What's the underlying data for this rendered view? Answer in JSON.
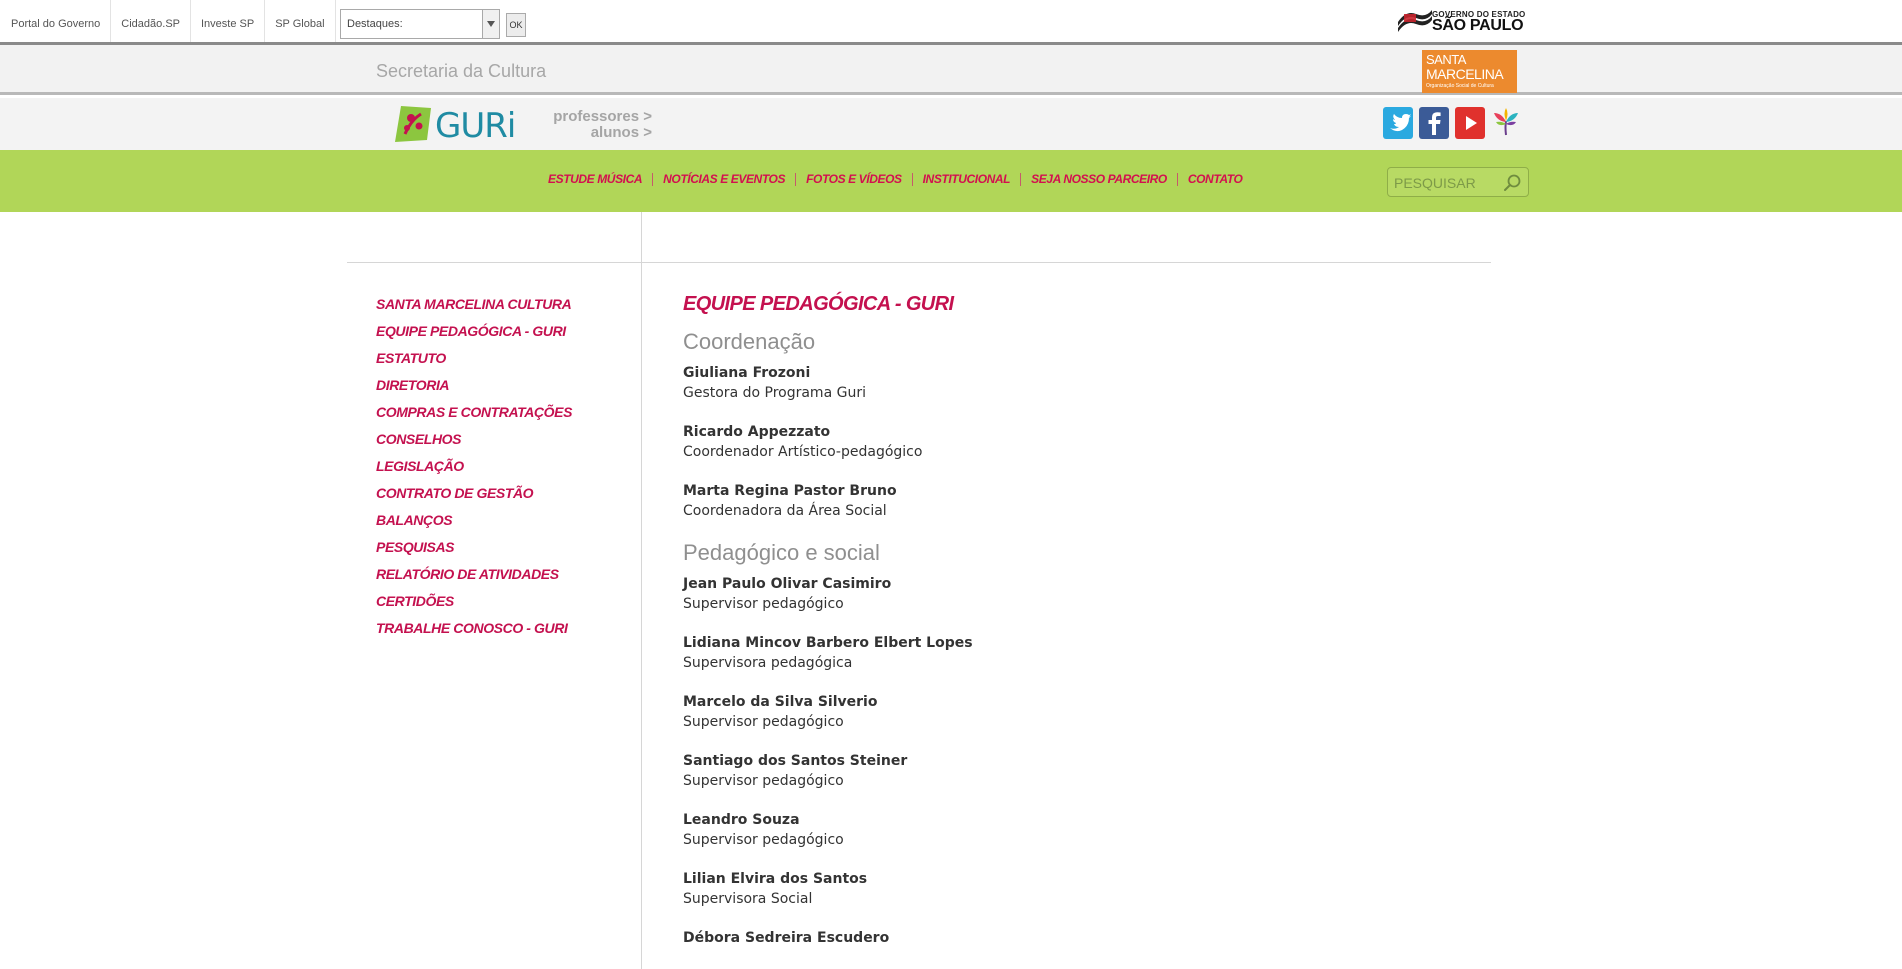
{
  "gov_bar": {
    "links": [
      "Portal do Governo",
      "Cidadão.SP",
      "Investe SP",
      "SP Global"
    ],
    "destaques_select": "Destaques:",
    "ok_label": "OK",
    "gov_logo_line1": "GOVERNO DO ESTADO",
    "gov_logo_line2": "SÃO PAULO"
  },
  "secretaria": {
    "title": "Secretaria da Cultura",
    "sm_logo_line1": "SANTA",
    "sm_logo_line2": "MARCELINA",
    "sm_logo_line3": "Organização Social de Cultura"
  },
  "guri_bar": {
    "logo_text": "GURi",
    "links": [
      "professores >",
      "alunos >"
    ],
    "social_icons": [
      "twitter-icon",
      "facebook-icon",
      "youtube-icon",
      "flower-icon"
    ]
  },
  "nav": {
    "items": [
      "ESTUDE MÚSICA",
      "NOTÍCIAS E EVENTOS",
      "FOTOS E VÍDEOS",
      "INSTITUCIONAL",
      "SEJA NOSSO PARCEIRO",
      "CONTATO"
    ],
    "search_placeholder": "PESQUISAR"
  },
  "sidebar": {
    "items": [
      "SANTA MARCELINA CULTURA",
      "EQUIPE PEDAGÓGICA - GURI",
      "ESTATUTO",
      "DIRETORIA",
      "COMPRAS E CONTRATAÇÕES",
      "CONSELHOS",
      "LEGISLAÇÃO",
      "CONTRATO DE GESTÃO",
      "BALANÇOS",
      "PESQUISAS",
      "RELATÓRIO DE ATIVIDADES",
      "CERTIDÕES",
      "TRABALHE CONOSCO - GURI"
    ]
  },
  "main": {
    "title": "EQUIPE PEDAGÓGICA - GURI",
    "sections": [
      {
        "heading": "Coordenação",
        "people": [
          {
            "name": "Giuliana Frozoni",
            "role": "Gestora do Programa Guri"
          },
          {
            "name": "Ricardo Appezzato",
            "role": "Coordenador Artístico-pedagógico"
          },
          {
            "name": "Marta Regina Pastor Bruno",
            "role": "Coordenadora da Área Social"
          }
        ]
      },
      {
        "heading": "Pedagógico e social",
        "people": [
          {
            "name": "Jean Paulo Olivar Casimiro",
            "role": "Supervisor pedagógico"
          },
          {
            "name": "Lidiana Mincov Barbero Elbert Lopes",
            "role": "Supervisora pedagógica"
          },
          {
            "name": "Marcelo da Silva Silverio",
            "role": "Supervisor pedagógico"
          },
          {
            "name": "Santiago dos Santos Steiner",
            "role": "Supervisor pedagógico"
          },
          {
            "name": "Leandro Souza",
            "role": "Supervisor pedagógico"
          },
          {
            "name": "Lilian Elvira dos Santos",
            "role": "Supervisora Social"
          },
          {
            "name": "Débora Sedreira Escudero",
            "role": ""
          }
        ]
      }
    ]
  },
  "colors": {
    "accent_magenta": "#c4114f",
    "nav_green": "#b1d658",
    "guri_teal": "#1f8ba3",
    "sm_orange": "#ec8a2e"
  }
}
